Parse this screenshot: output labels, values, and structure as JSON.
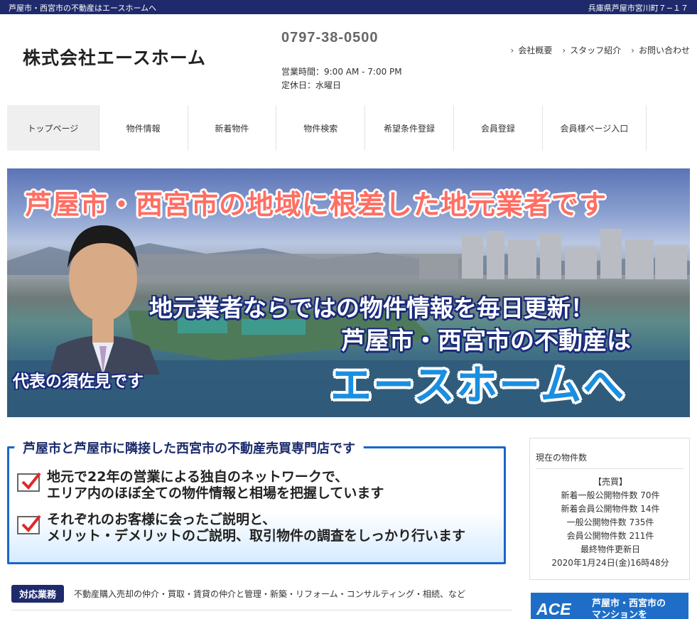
{
  "topbar": {
    "tagline": "芦屋市・西宮市の不動産はエースホームへ",
    "address": "兵庫県芦屋市宮川町７−１７"
  },
  "header": {
    "company": "株式会社エースホーム",
    "phone": "0797-38-0500",
    "hours": "営業時間：9:00 AM - 7:00 PM",
    "closed": "定休日：水曜日",
    "links": [
      "会社概要",
      "スタッフ紹介",
      "お問い合わせ"
    ]
  },
  "nav": {
    "items": [
      "トップページ",
      "物件情報",
      "新着物件",
      "物件検索",
      "希望条件登録",
      "会員登録",
      "会員様ページ入口"
    ]
  },
  "hero": {
    "line1": "芦屋市・西宮市の地域に根差した地元業者です",
    "line2": "地元業者ならではの物件情報を毎日更新！",
    "line3": "芦屋市・西宮市の不動産は",
    "line4": "エースホームへ",
    "rep": "代表の須佐見です"
  },
  "intro": {
    "heading": "芦屋市と芦屋市に隣接した西宮市の不動産売買専門店です",
    "point1_a": "地元で22年の営業による独自のネットワークで、",
    "point1_b": "エリア内のほぼ全ての物件情報と相場を把握しています",
    "point2_a": "それぞれのお客様に会ったご説明と、",
    "point2_b": "メリット・デメリットのご説明、取引物件の調査をしっかり行います"
  },
  "services": {
    "label": "対応業務",
    "text": "不動産購入売却の仲介・買取・賃貸の仲介と管理・新築・リフォーム・コンサルティング・相続、など"
  },
  "sidebar": {
    "title": "現在の物件数",
    "section": "【売買】",
    "stats": [
      "新着一般公開物件数 70件",
      "新着会員公開物件数 14件",
      "一般公開物件数 735件",
      "会員公開物件数 211件",
      "最終物件更新日",
      "2020年1月24日(金)16時48分"
    ]
  },
  "ad": {
    "logo": "ACE",
    "text_a": "芦屋市・西宮市の",
    "text_b": "マンションを"
  },
  "colors": {
    "navy": "#1e2a6b",
    "accent_blue": "#1966cc",
    "hero_red": "#ff6e63",
    "hero_blue": "#1a8fe0"
  }
}
